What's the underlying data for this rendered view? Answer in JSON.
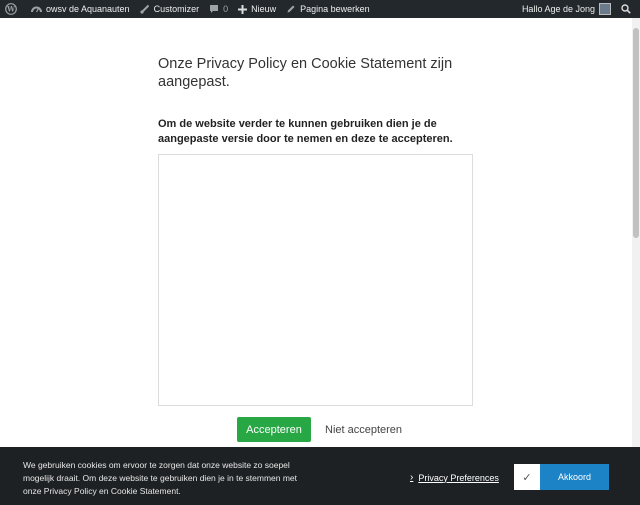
{
  "adminbar": {
    "site_name": "owsv de Aquanauten",
    "customizer": "Customizer",
    "comments_count": "0",
    "new": "Nieuw",
    "edit_page": "Pagina bewerken",
    "greeting": "Hallo Age de Jong"
  },
  "main": {
    "title": "Onze Privacy Policy en Cookie Statement zijn aangepast.",
    "subtitle": "Om de website verder te kunnen gebruiken dien je de aangepaste versie door te nemen en deze te accepteren.",
    "accept_label": "Accepteren",
    "decline_label": "Niet accepteren"
  },
  "cookiebar": {
    "text": "We gebruiken cookies om ervoor te zorgen dat onze website zo soepel mogelijk draait. Om deze website te gebruiken dien je in te stemmen met onze Privacy Policy en Cookie Statement.",
    "preferences_label": "Privacy Preferences",
    "accept_label": "Akkoord",
    "check_symbol": "✓"
  },
  "colors": {
    "adminbar_bg": "#23282d",
    "accept_green": "#28a745",
    "akkoord_blue": "#1c84c6",
    "cookiebar_bg": "#1e2124"
  }
}
